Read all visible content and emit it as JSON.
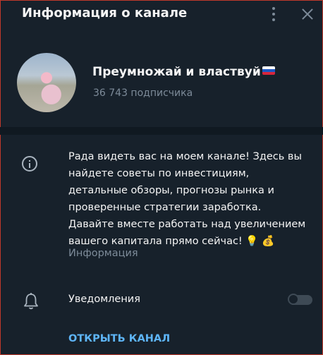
{
  "header": {
    "title": "Информация о канале",
    "more_icon": "more-vertical-icon",
    "close_icon": "close-icon"
  },
  "channel": {
    "name": "Преумножай и властвуй",
    "flag": "russian-flag",
    "subscribers": "36 743 подписчика"
  },
  "description": {
    "lines": [
      "Рада видеть вас на моем канале! Здесь вы",
      "найдете советы по инвестициям,",
      "детальные обзоры, прогнозы рынка и",
      "проверенные стратегии заработка.",
      "Давайте вместе работать над увеличением",
      "вашего капитала прямо сейчас! 💡 💰"
    ],
    "label": "Информация"
  },
  "notifications": {
    "label": "Уведомления",
    "enabled": false
  },
  "actions": {
    "open_channel": "ОТКРЫТЬ КАНАЛ"
  },
  "colors": {
    "background": "#17212b",
    "accent": "#5eb5f7",
    "muted": "#7d8b99"
  }
}
